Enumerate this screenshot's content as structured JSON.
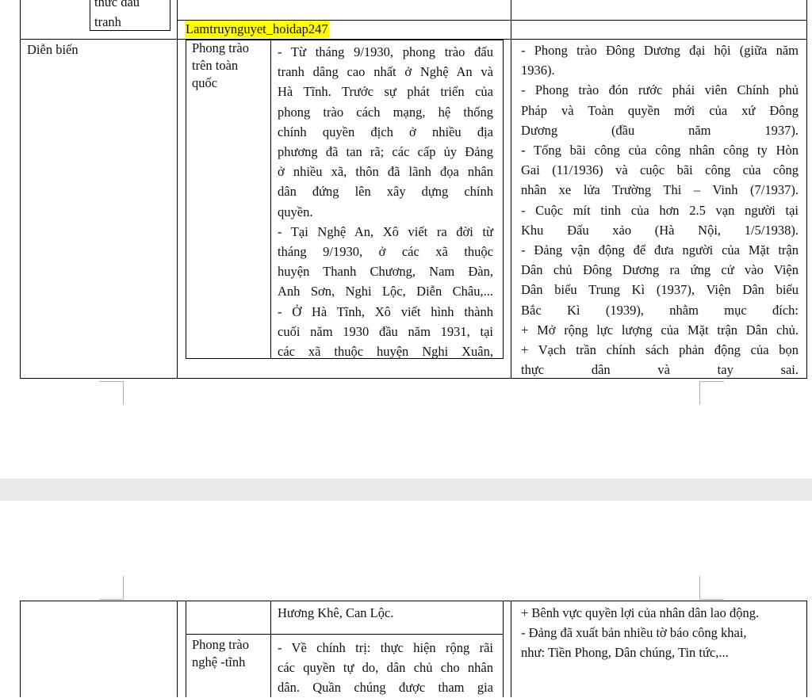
{
  "page1": {
    "top_label_lines": [
      "thức đấu",
      "tranh"
    ],
    "watermark": "Lamtruynguyet_hoidap247",
    "row_label": "Diễn biến",
    "sub_label_lines": [
      "Phong trào",
      "trên toàn",
      "quốc"
    ],
    "middle_lines": [
      "- Từ tháng 9/1930, phong trào đấu",
      "tranh dâng cao nhất ở Nghệ An và",
      "Hà Tĩnh. Trước sự phát triển của",
      "phong trào cách mạng, hệ thống",
      "chính quyền địch ở nhiều địa",
      "phương đã tan rã; các cấp ủy Đảng",
      "ở nhiều xã, thôn đã lãnh đọa nhân",
      "dân đứng lên xây dựng chính",
      "quyền.",
      "- Tại Nghệ An, Xô viết ra đời từ",
      "tháng 9/1930, ở các xã thuộc",
      "huyện Thanh Chương, Nam Đàn,",
      "Anh Sơn, Nghi Lộc, Diễn Châu,...",
      "- Ở Hà Tĩnh, Xô viết hình thành",
      "cuối năm 1930 đầu năm 1931, tại",
      "các xã thuộc huyện Nghi Xuân,"
    ],
    "right_lines": [
      "- Phong trào Đông Dương đại hội (giữa năm",
      "1936).",
      "- Phong trào đón rước phái viên Chính phủ",
      "Pháp và Toàn quyền mới của xứ Đông",
      "Dương (đầu năm 1937).",
      "- Tổng bãi công của công nhân công ty Hòn",
      "Gai (11/1936) và cuộc bãi công của công",
      "nhân xe lửa Trường Thi – Vinh (7/1937).",
      "- Cuộc mít tinh của hơn 2.5 vạn người tại",
      "Khu Đấu xảo (Hà Nội, 1/5/1938).",
      "- Đảng vận động để đưa người của Mặt trận",
      "Dân chủ Đông Dương ra ứng cử vào Viện",
      "Dân biểu Trung Kì (1937), Viện Dân biểu",
      "Bắc Kì (1939), nhằm mục đích:",
      "+ Mở rộng lực lượng của Mặt trận Dân chủ.",
      "+ Vạch trần chính sách phản động của bọn",
      "thực dân và tay sai."
    ]
  },
  "page2": {
    "middle_first_line": "Hương Khê, Can Lộc.",
    "sub_label_lines": [
      "Phong trào",
      "nghệ -tĩnh"
    ],
    "middle_lines": [
      "- Về chính trị: thực hiện rộng rãi",
      "các quyền tự do, dân chủ cho nhân",
      "dân. Quần chúng được tham gia"
    ],
    "right_lines": [
      "+ Bênh vực quyền lợi của nhân dân lao động.",
      "- Đảng đã xuất bản nhiều tờ báo công khai,",
      "như: Tiền Phong, Dân chúng, Tin tức,..."
    ]
  }
}
